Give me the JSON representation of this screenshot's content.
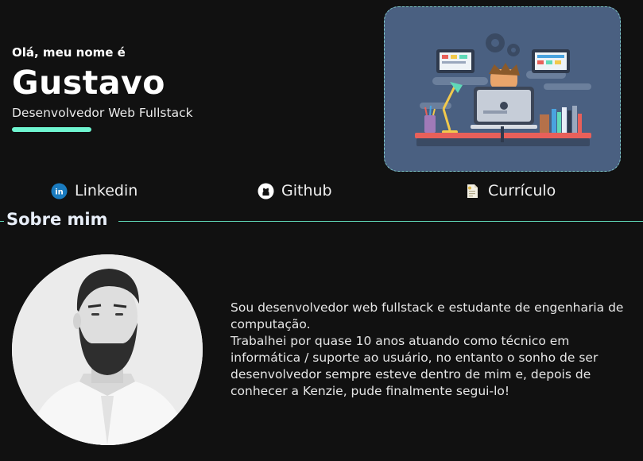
{
  "hero": {
    "greeting": "Olá, meu nome é",
    "name": "Gustavo",
    "role": "Desenvolvedor Web Fullstack",
    "accent_color": "#6ff5d0"
  },
  "illustration": {
    "icon": "developer-desk-illustration"
  },
  "links": [
    {
      "label": "Linkedin",
      "icon": "linkedin-icon"
    },
    {
      "label": "Github",
      "icon": "github-icon"
    },
    {
      "label": "Currículo",
      "icon": "document-icon"
    }
  ],
  "about": {
    "title": "Sobre mim",
    "paragraph_1": "Sou desenvolvedor web fullstack e estudante de engenharia de computação.",
    "paragraph_2": "Trabalhei por quase 10 anos atuando como técnico em informática / suporte ao usuário, no entanto o sonho de ser desenvolvedor sempre esteve dentro de mim e, depois de conhecer a Kenzie, pude finalmente segui-lo!"
  },
  "colors": {
    "background": "#111111",
    "frame_bg": "#4a6081",
    "line": "#5fd9b8"
  }
}
